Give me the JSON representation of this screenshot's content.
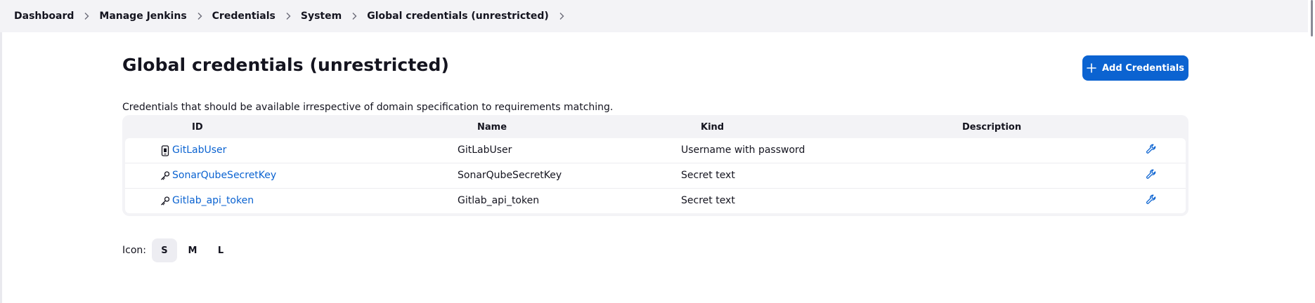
{
  "breadcrumb": [
    {
      "label": "Dashboard"
    },
    {
      "label": "Manage Jenkins"
    },
    {
      "label": "Credentials"
    },
    {
      "label": "System"
    },
    {
      "label": "Global credentials (unrestricted)"
    }
  ],
  "page": {
    "title": "Global credentials (unrestricted)",
    "description": "Credentials that should be available irrespective of domain specification to requirements matching.",
    "add_button_label": "Add Credentials",
    "accent_color": "#0b63d1"
  },
  "table": {
    "headers": {
      "id": "ID",
      "name": "Name",
      "kind": "Kind",
      "description": "Description"
    },
    "rows": [
      {
        "icon": "mobile-icon",
        "id": "GitLabUser",
        "name": "GitLabUser",
        "kind": "Username with password",
        "description": ""
      },
      {
        "icon": "key-icon",
        "id": "SonarQubeSecretKey",
        "name": "SonarQubeSecretKey",
        "kind": "Secret text",
        "description": ""
      },
      {
        "icon": "key-icon",
        "id": "Gitlab_api_token",
        "name": "Gitlab_api_token",
        "kind": "Secret text",
        "description": ""
      }
    ]
  },
  "icon_size": {
    "label": "Icon:",
    "options": [
      "S",
      "M",
      "L"
    ],
    "selected": "S"
  }
}
